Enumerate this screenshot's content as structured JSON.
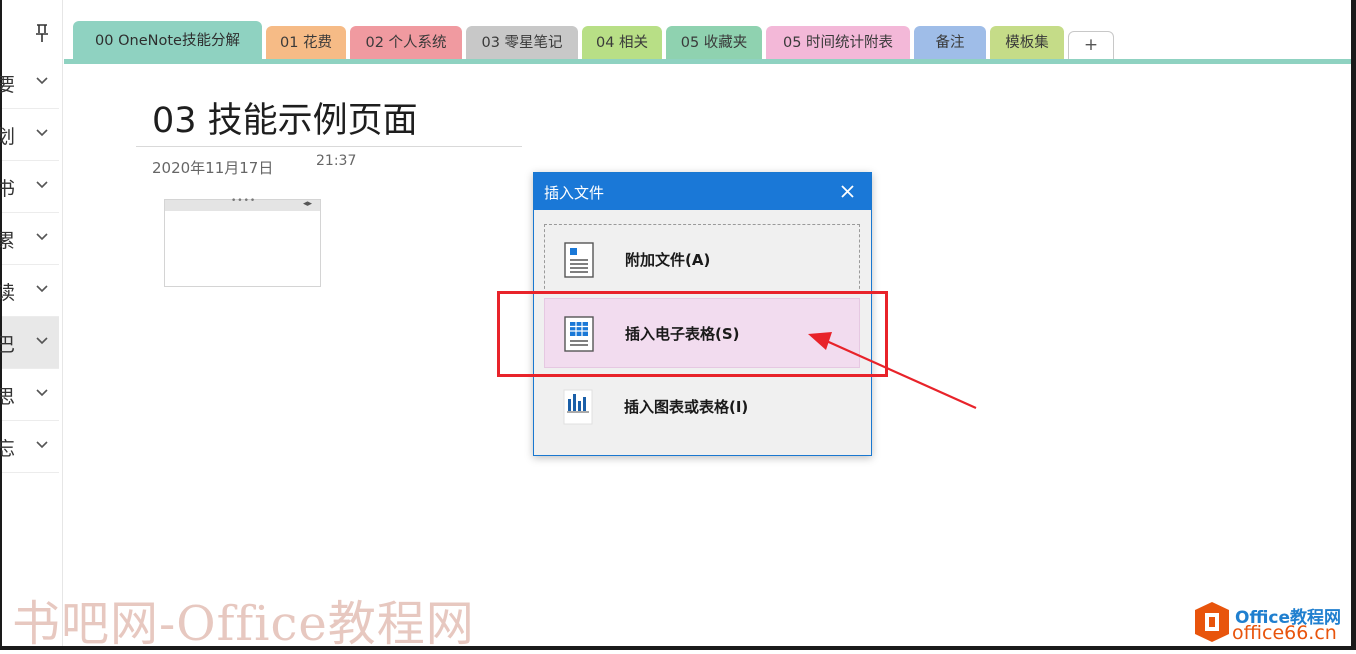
{
  "tabs": [
    {
      "label": "00 OneNote技能分解",
      "color": "#8fd2c1"
    },
    {
      "label": "01 花费",
      "color": "#f6bb86"
    },
    {
      "label": "02 个人系统",
      "color": "#f09aa0"
    },
    {
      "label": "03 零星笔记",
      "color": "#c8c8c8"
    },
    {
      "label": "04 相关",
      "color": "#b8df86"
    },
    {
      "label": "05 收藏夹",
      "color": "#8fd2b0"
    },
    {
      "label": "05 时间统计附表",
      "color": "#f3b8d8"
    },
    {
      "label": "备注",
      "color": "#9fbde8"
    },
    {
      "label": "模板集",
      "color": "#c5dc88"
    }
  ],
  "add_tab_label": "+",
  "sections": [
    {
      "char": "要"
    },
    {
      "char": "划"
    },
    {
      "char": "书"
    },
    {
      "char": "累"
    },
    {
      "char": "读"
    },
    {
      "char": "巴"
    },
    {
      "char": "思"
    },
    {
      "char": "忘"
    }
  ],
  "page": {
    "title": "03 技能示例页面",
    "date": "2020年11月17日",
    "time": "21:37"
  },
  "frame": {
    "dots": "••••",
    "arrows": "◂▸"
  },
  "dialog": {
    "title": "插入文件",
    "options": [
      {
        "label": "附加文件(A)",
        "icon": "document-icon"
      },
      {
        "label": "插入电子表格(S)",
        "icon": "spreadsheet-icon"
      },
      {
        "label": "插入图表或表格(I)",
        "icon": "chart-icon"
      }
    ]
  },
  "watermark": {
    "left": "书吧网-Office教程网",
    "right_top": "Office教程网",
    "right_bottom": "office66.cn"
  },
  "colors": {
    "accent": "#1a78d7",
    "highlight": "#e8232a",
    "selected": "#f2dcef"
  }
}
